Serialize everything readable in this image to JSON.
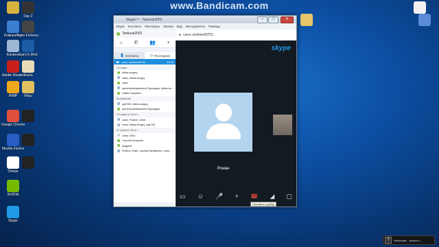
{
  "watermark": "www.Bandicam.com",
  "desktop_icons": [
    {
      "label": "",
      "color": "#d8b33f"
    },
    {
      "label": "Компьютер",
      "color": "#3b7fd1"
    },
    {
      "label": "Корзина",
      "color": "#9bb7d4"
    },
    {
      "label": "Adobe Reader",
      "color": "#c8211d"
    },
    {
      "label": "AIMP",
      "color": "#f0a81c"
    },
    {
      "label": "Google Chrome",
      "color": "#e14f3c"
    },
    {
      "label": "Mozilla Firefox",
      "color": "#2a5ec4"
    },
    {
      "label": "Опера",
      "color": "#ffffff"
    },
    {
      "label": "NVIDIA",
      "color": "#75b900"
    },
    {
      "label": "Skype",
      "color": "#1f9be6"
    },
    {
      "label": "Day Z",
      "color": "#333333"
    },
    {
      "label": "Team Fortress 2",
      "color": "#444444"
    },
    {
      "label": "Garry's Mod",
      "color": "#1b5da6"
    },
    {
      "label": "Книга",
      "color": "#e8dcb8"
    },
    {
      "label": "Игры",
      "color": "#e0c060"
    },
    {
      "label": "",
      "color": "#222222"
    },
    {
      "label": "",
      "color": "#222222"
    },
    {
      "label": "",
      "color": "#222222"
    },
    {
      "label": "",
      "color": "#e7c66a"
    },
    {
      "label": "",
      "color": "#f2f2f2"
    },
    {
      "label": "",
      "color": "#5a8ad8"
    }
  ],
  "window": {
    "title": "Skype™ - Tanksuk2001",
    "menu": [
      "Skype",
      "Контакты",
      "Разговоры",
      "Звонки",
      "Вид",
      "Инструменты",
      "Помощь"
    ],
    "user": "Tanksuk2001",
    "tabs": {
      "contacts": "Контакты",
      "recent": "Последние"
    },
    "active_call": {
      "label": "саня, andrew93751",
      "duration": "00:28"
    },
    "sections": [
      {
        "title": "Сегодня",
        "items": [
          {
            "name": "tolkla.sergey",
            "status": "online"
          },
          {
            "name": "саня, tolkla.sergey",
            "status": "group"
          },
          {
            "name": "саня",
            "status": "online"
          },
          {
            "name": "aymen(ashadsaken) Бригадир, tolkla.se...",
            "status": "group"
          },
          {
            "name": "Павел Кокунин",
            "status": "online"
          }
        ]
      },
      {
        "title": "Вчерашние",
        "items": [
          {
            "name": "yak760, tolkla.sergey",
            "status": "group"
          },
          {
            "name": "aymen(ashadsaken) Бригадир",
            "status": "online"
          }
        ]
      },
      {
        "title": "23 апреля 2014 г.",
        "items": [
          {
            "name": "саня, Rodion_Dark",
            "status": "group"
          },
          {
            "name": "саня, tolkla.sergey, yak760",
            "status": "group"
          }
        ]
      },
      {
        "title": "11 апреля 2014 г.",
        "items": [
          {
            "name": "victor 2001",
            "status": "offline"
          },
          {
            "name": "Сергей Кулешов",
            "status": "online"
          },
          {
            "name": "Андрей",
            "status": "online"
          },
          {
            "name": "Rodion_Dark, оксана булавкина, саня",
            "status": "group"
          }
        ]
      }
    ],
    "call_header": "саня, andrew93751",
    "skype_logo": "skype",
    "caller_name": "Роман",
    "hangup_tooltip": "Положить трубку",
    "control_icons": [
      "screen-icon",
      "emoticon-icon",
      "mic-icon",
      "add-icon",
      "hangup-icon",
      "signal-icon",
      "window-icon"
    ]
  },
  "notification": {
    "text": "Неисправ... запуск и ...",
    "icon": "?"
  },
  "colors": {
    "accent": "#1d8fde",
    "hangup": "#e0463a",
    "avatar_bg": "#b3d4ee",
    "call_bg": "#141a22"
  }
}
